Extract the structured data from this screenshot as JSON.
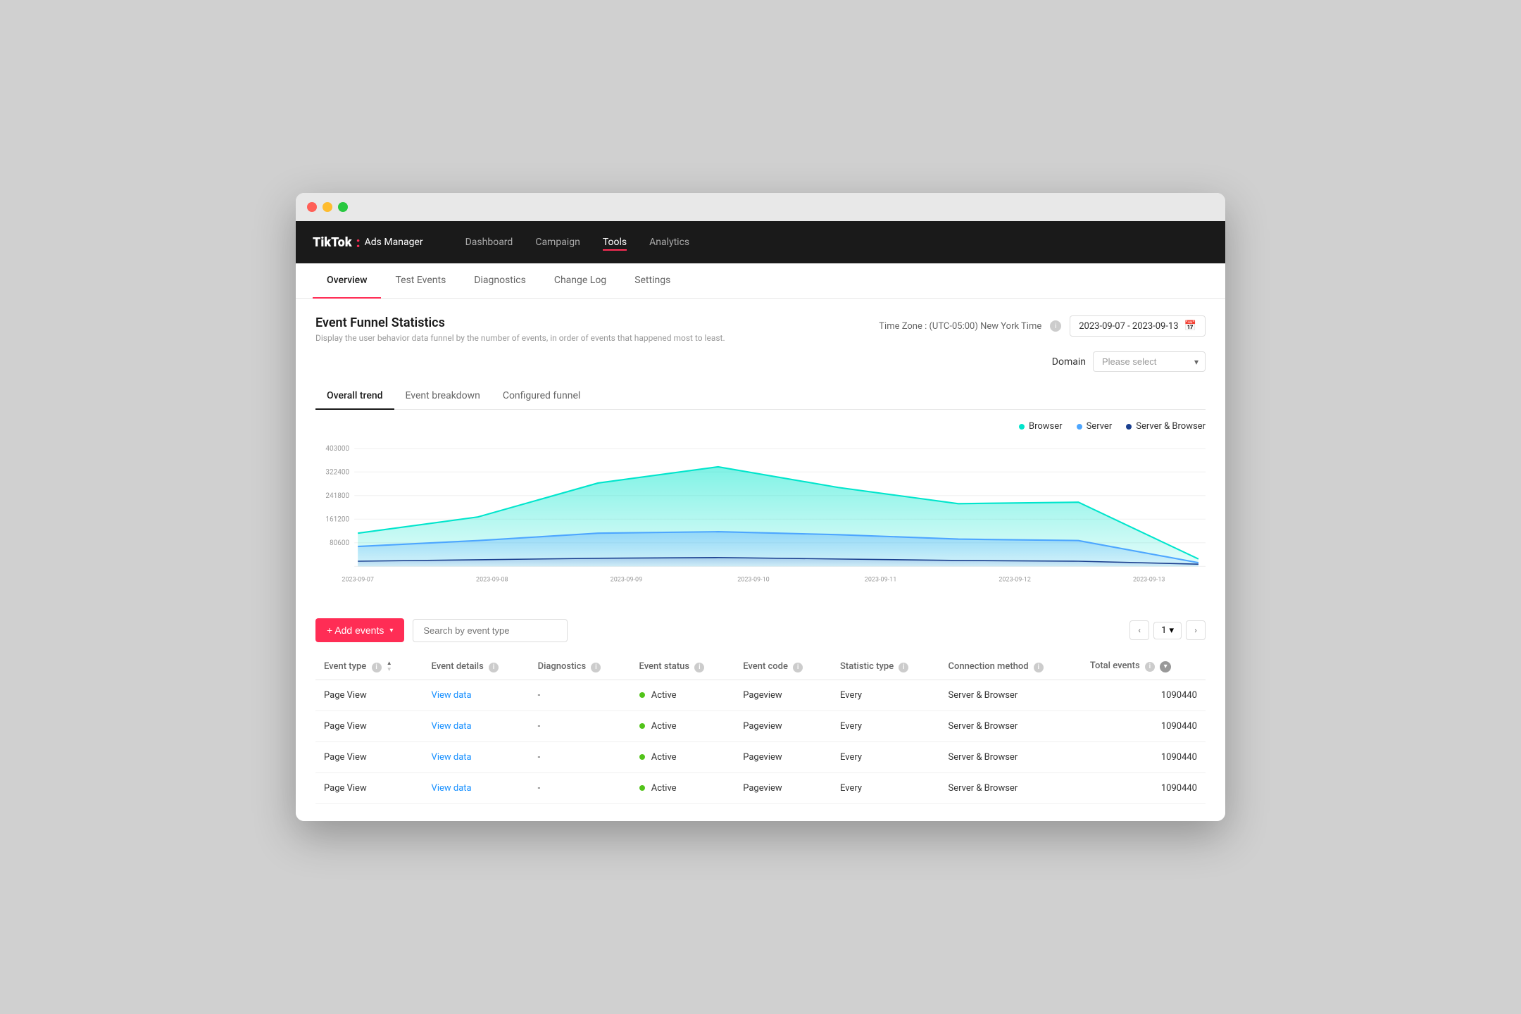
{
  "window": {
    "title": "TikTok Ads Manager"
  },
  "brand": {
    "name": "TikTok",
    "colon": ":",
    "sub": "Ads Manager"
  },
  "nav": {
    "items": [
      {
        "label": "Dashboard",
        "active": false
      },
      {
        "label": "Campaign",
        "active": false
      },
      {
        "label": "Tools",
        "active": true
      },
      {
        "label": "Analytics",
        "active": false
      }
    ]
  },
  "sub_tabs": {
    "items": [
      {
        "label": "Overview",
        "active": true
      },
      {
        "label": "Test Events",
        "active": false
      },
      {
        "label": "Diagnostics",
        "active": false
      },
      {
        "label": "Change Log",
        "active": false
      },
      {
        "label": "Settings",
        "active": false
      }
    ]
  },
  "funnel": {
    "title": "Event Funnel Statistics",
    "description": "Display the user behavior data funnel by the number of events, in order of events that happened most to least.",
    "timezone_label": "Time Zone : (UTC-05:00) New York Time",
    "date_range": "2023-09-07  -  2023-09-13",
    "domain_label": "Domain",
    "domain_placeholder": "Please select"
  },
  "trend_tabs": {
    "items": [
      {
        "label": "Overall trend",
        "active": true
      },
      {
        "label": "Event breakdown",
        "active": false
      },
      {
        "label": "Configured funnel",
        "active": false
      }
    ]
  },
  "chart": {
    "legend": [
      {
        "label": "Browser",
        "color": "#00e5cc"
      },
      {
        "label": "Server",
        "color": "#4da6ff"
      },
      {
        "label": "Server & Browser",
        "color": "#1a3f8f"
      }
    ],
    "y_labels": [
      "403000",
      "322400",
      "241800",
      "161200",
      "80600",
      ""
    ],
    "x_labels": [
      "2023-09-07",
      "2023-09-08",
      "2023-09-09",
      "2023-09-10",
      "2023-09-11",
      "2023-09-12",
      "2023-09-13"
    ]
  },
  "events_bar": {
    "add_button": "+ Add events",
    "search_placeholder": "Search by event type",
    "page_number": "1"
  },
  "table": {
    "headers": [
      {
        "label": "Event type",
        "info": true,
        "sortable": true
      },
      {
        "label": "Event details",
        "info": true
      },
      {
        "label": "Diagnostics",
        "info": true
      },
      {
        "label": "Event status",
        "info": true
      },
      {
        "label": "Event code",
        "info": true
      },
      {
        "label": "Statistic type",
        "info": true
      },
      {
        "label": "Connection method",
        "info": true
      },
      {
        "label": "Total events",
        "info": true,
        "sortable": true,
        "align": "right"
      }
    ],
    "rows": [
      {
        "event_type": "Page View",
        "event_details": "View data",
        "diagnostics": "-",
        "status": "Active",
        "event_code": "Pageview",
        "statistic_type": "Every",
        "connection_method": "Server & Browser",
        "total_events": "1090440"
      },
      {
        "event_type": "Page View",
        "event_details": "View data",
        "diagnostics": "-",
        "status": "Active",
        "event_code": "Pageview",
        "statistic_type": "Every",
        "connection_method": "Server & Browser",
        "total_events": "1090440"
      },
      {
        "event_type": "Page View",
        "event_details": "View data",
        "diagnostics": "-",
        "status": "Active",
        "event_code": "Pageview",
        "statistic_type": "Every",
        "connection_method": "Server & Browser",
        "total_events": "1090440"
      },
      {
        "event_type": "Page View",
        "event_details": "View data",
        "diagnostics": "-",
        "status": "Active",
        "event_code": "Pageview",
        "statistic_type": "Every",
        "connection_method": "Server & Browser",
        "total_events": "1090440"
      }
    ]
  }
}
